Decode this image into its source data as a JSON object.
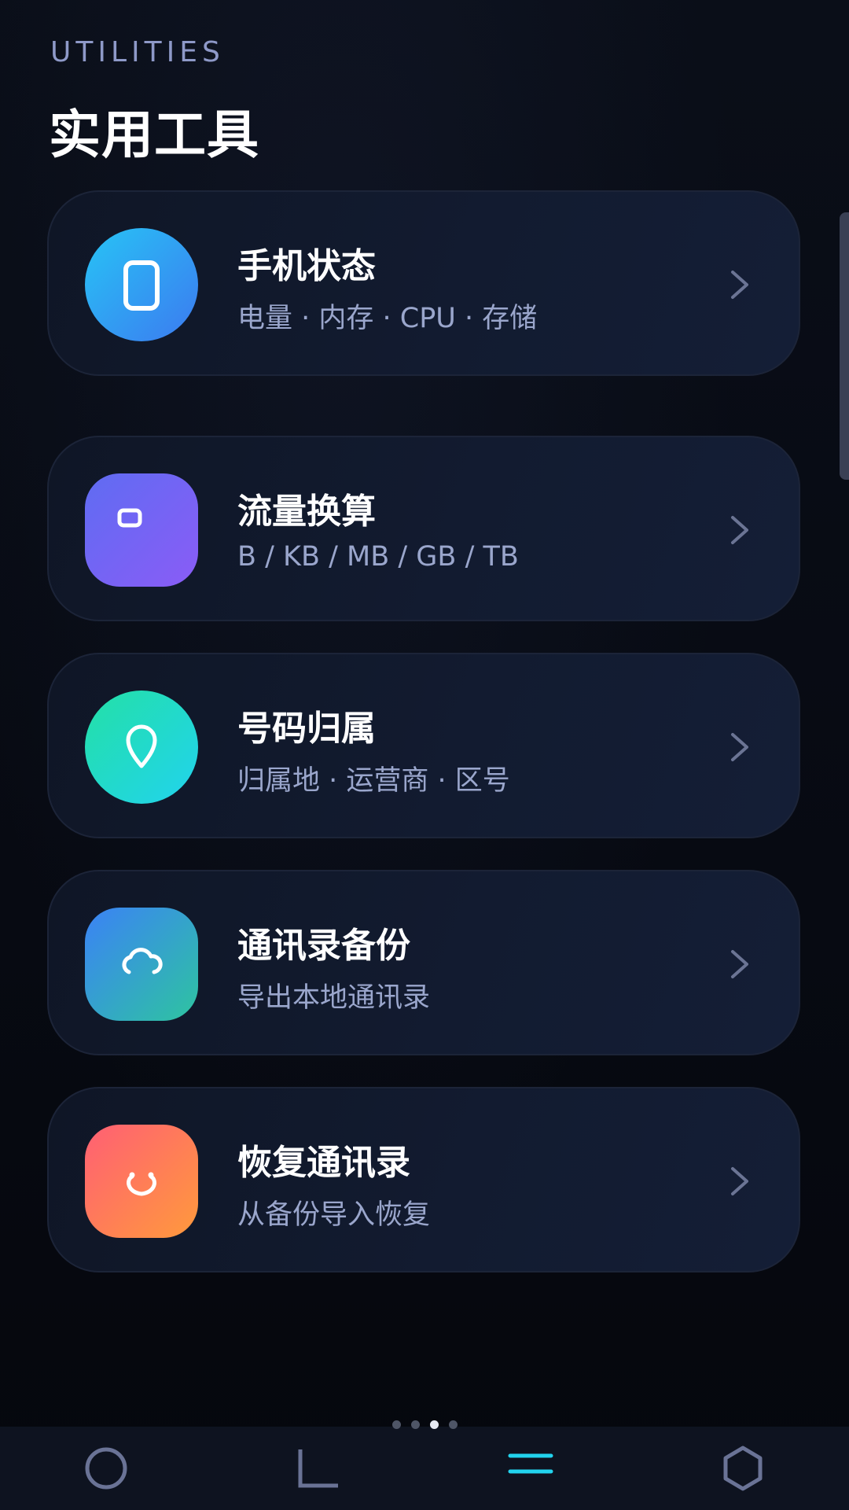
{
  "header": {
    "kicker": "UTILITIES",
    "title": "实用工具"
  },
  "tools": [
    {
      "id": "phone-status",
      "title": "手机状态",
      "subtitle": "电量 · 内存 · CPU · 存储",
      "icon": "phone-icon",
      "color_from": "#27c4f5",
      "color_to": "#3c7af0"
    },
    {
      "id": "data-convert",
      "title": "流量换算",
      "subtitle": "B / KB / MB / GB / TB",
      "icon": "data-chip-icon",
      "color_from": "#5f6cf2",
      "color_to": "#8a5cf6"
    },
    {
      "id": "number-lookup",
      "title": "号码归属",
      "subtitle": "归属地 · 运营商 · 区号",
      "icon": "location-pin-icon",
      "color_from": "#23e0a6",
      "color_to": "#22d3ee"
    },
    {
      "id": "contacts-backup",
      "title": "通讯录备份",
      "subtitle": "导出本地通讯录",
      "icon": "cloud-icon",
      "color_from": "#3b82f6",
      "color_to": "#2ec4a0"
    },
    {
      "id": "contacts-restore",
      "title": "恢复通讯录",
      "subtitle": "从备份导入恢复",
      "icon": "restore-icon",
      "color_from": "#ff5f74",
      "color_to": "#ff9a3c"
    }
  ],
  "pagination": {
    "count": 4,
    "active_index": 2
  },
  "bottom_nav": {
    "items": [
      {
        "icon": "circle-icon",
        "active": false
      },
      {
        "icon": "corner-icon",
        "active": false
      },
      {
        "icon": "menu-icon",
        "active": true
      },
      {
        "icon": "hexagon-icon",
        "active": false
      }
    ],
    "active_color": "#22d3ee",
    "inactive_color": "#6a7396"
  }
}
